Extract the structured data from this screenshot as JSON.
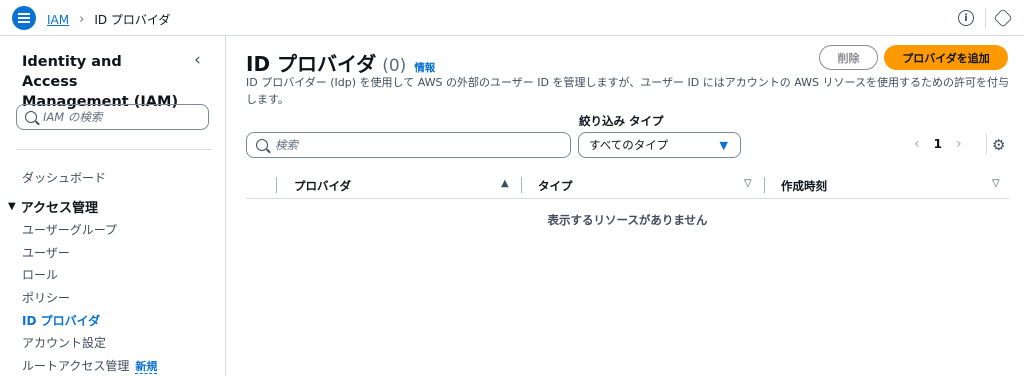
{
  "topbar": {
    "menu_icon": "hamburger-menu-icon",
    "breadcrumb": {
      "root": "IAM",
      "separator": "›",
      "current": "ID プロバイダ"
    },
    "info_icon": "info-icon",
    "settings_icon": "settings-icon"
  },
  "sidebar": {
    "title": "Identity and Access Management (IAM)",
    "close_glyph": "‹",
    "search_placeholder": "IAM の検索",
    "dashboard": "ダッシュボード",
    "section_title": "アクセス管理",
    "items": [
      {
        "label": "ユーザーグループ",
        "active": false
      },
      {
        "label": "ユーザー",
        "active": false
      },
      {
        "label": "ロール",
        "active": false
      },
      {
        "label": "ポリシー",
        "active": false
      },
      {
        "label": "ID プロバイダ",
        "active": true
      },
      {
        "label": "アカウント設定",
        "active": false
      },
      {
        "label": "ルートアクセス管理",
        "active": false,
        "badge": "新規"
      }
    ]
  },
  "main": {
    "title": "ID プロバイダ",
    "count": "(0)",
    "info_link": "情報",
    "delete_button": "削除",
    "add_button": "プロバイダを追加",
    "description": "ID プロバイダー (Idp) を使用して AWS の外部のユーザー ID を管理しますが、ユーザー ID にはアカウントの AWS リソースを使用するための許可を付与します。",
    "filter_label": "絞り込み タイプ",
    "search_placeholder": "検索",
    "type_select_value": "すべてのタイプ",
    "pagination": {
      "prev": "‹",
      "page": "1",
      "next": "›"
    },
    "table": {
      "columns": [
        "プロバイダ",
        "タイプ",
        "作成時刻"
      ],
      "empty_message": "表示するリソースがありません"
    }
  },
  "colors": {
    "accent": "#0972d3",
    "primary_button": "#ff9900",
    "border": "#d5dbdb",
    "text": "#0f141a"
  }
}
